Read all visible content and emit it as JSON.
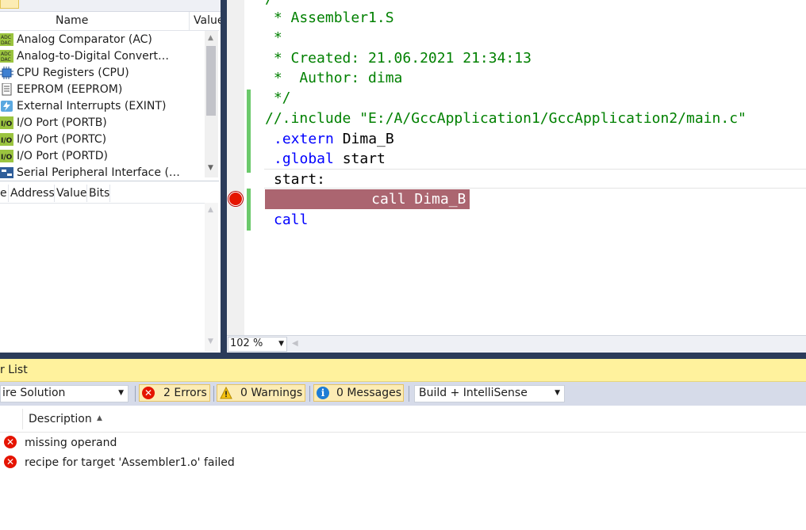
{
  "properties": {
    "header_name": "Name",
    "header_value": "Value",
    "items": [
      {
        "label": "Analog Comparator (AC)",
        "icon": "adc-dac-icon"
      },
      {
        "label": "Analog-to-Digital Convert…",
        "icon": "adc-dac-icon"
      },
      {
        "label": "CPU Registers (CPU)",
        "icon": "cpu-chip-icon"
      },
      {
        "label": "EEPROM (EEPROM)",
        "icon": "document-icon"
      },
      {
        "label": "External Interrupts (EXINT)",
        "icon": "interrupt-icon"
      },
      {
        "label": "I/O Port (PORTB)",
        "icon": "io-port-icon"
      },
      {
        "label": "I/O Port (PORTC)",
        "icon": "io-port-icon"
      },
      {
        "label": "I/O Port (PORTD)",
        "icon": "io-port-icon"
      },
      {
        "label": "Serial Peripheral Interface (…",
        "icon": "spi-icon"
      }
    ]
  },
  "registers": {
    "columns": [
      "e",
      "Address",
      "Value",
      "Bits"
    ]
  },
  "editor": {
    "lines": [
      {
        "text": "/",
        "color": "#008000"
      },
      {
        "text": " * Assembler1.S",
        "color": "#008000"
      },
      {
        "text": " *",
        "color": "#008000"
      },
      {
        "text": " * Created: 21.06.2021 21:34:13",
        "color": "#008000"
      },
      {
        "text": " *  Author: dima",
        "color": "#008000"
      },
      {
        "text": " */",
        "color": "#008000"
      },
      {
        "text": "//.include \"E:/A/GccApplication1/GccApplication2/main.c\"",
        "color": "#008000"
      }
    ],
    "extern_kw": ".extern",
    "extern_name": " Dima_B",
    "global_kw": ".global",
    "global_name": " start",
    "label_line": "start:",
    "bp_line": "     call Dima_B",
    "last_line": "call",
    "zoom": "102 %"
  },
  "error_list": {
    "title": "r List",
    "scope": "ire Solution",
    "errors_label": "2 Errors",
    "warnings_label": "0 Warnings",
    "messages_label": "0 Messages",
    "build_filter": "Build + IntelliSense",
    "desc_header": "Description",
    "rows": [
      {
        "text": "missing operand"
      },
      {
        "text": "recipe for target 'Assembler1.o' failed"
      }
    ]
  },
  "colors": {
    "breakpoint": "#e51400",
    "bp_highlight": "#ab6570",
    "panel_title": "#fff29d",
    "toolbar": "#d6dbe9",
    "frame": "#2b3c5a"
  }
}
